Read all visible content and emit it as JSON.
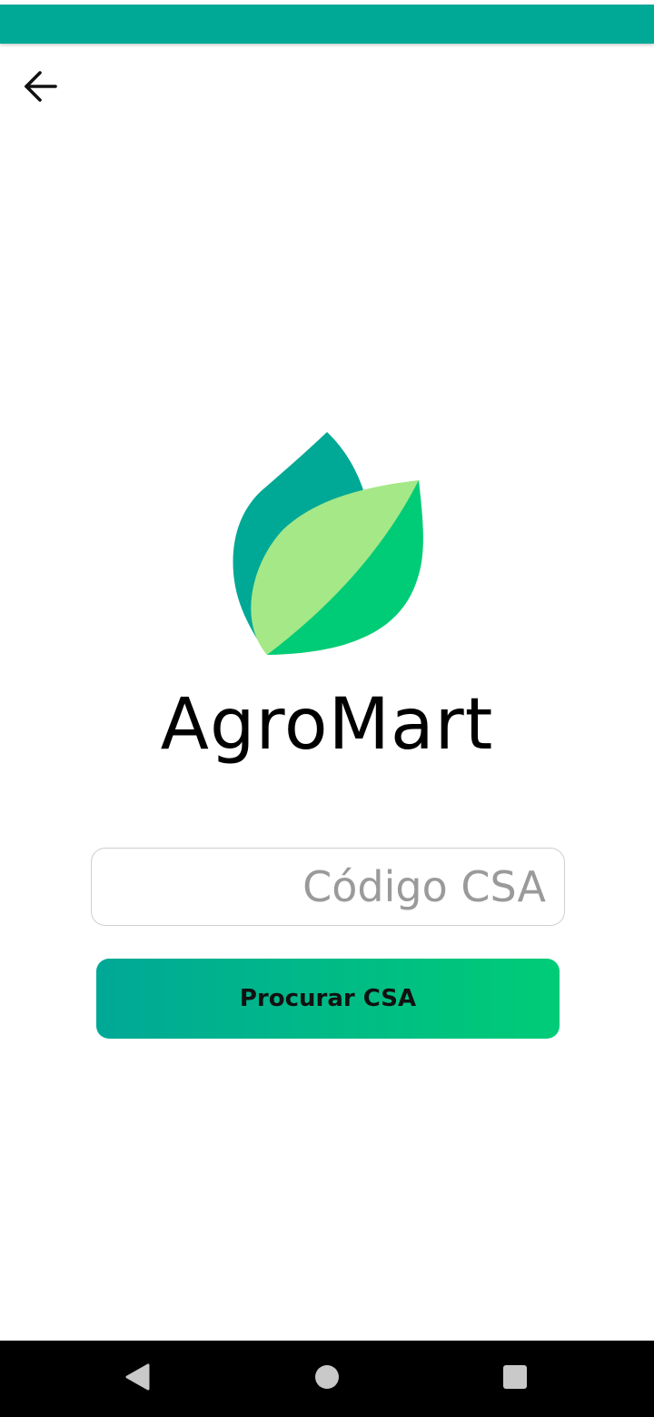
{
  "app": {
    "brand_name": "AgroMart",
    "accent_color": "#00a896",
    "accent_color_end": "#00cc77"
  },
  "toolbar": {
    "back_icon": "arrow-left-icon"
  },
  "logo": {
    "icon": "leaf-logo-icon",
    "colors": {
      "back_leaf": "#00a896",
      "front_leaf_light": "#a5e887",
      "front_leaf_dark": "#00cc77"
    }
  },
  "form": {
    "code_input": {
      "value": "",
      "placeholder": "Código CSA"
    },
    "search_button_label": "Procurar CSA"
  },
  "system_nav": {
    "back_icon": "nav-back-triangle-icon",
    "home_icon": "nav-home-circle-icon",
    "recents_icon": "nav-recents-square-icon"
  }
}
